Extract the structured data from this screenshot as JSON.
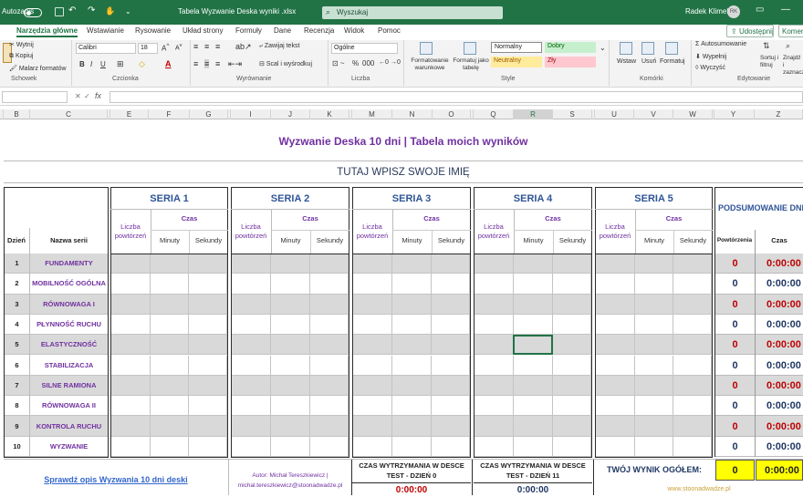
{
  "titlebar": {
    "autosave_label": "Autozapis",
    "doc_title": "Tabela Wyzwanie Deska wyniki .xlsx",
    "search_placeholder": "Wyszukaj",
    "user_name": "Radek Klimek",
    "user_initials": "RK"
  },
  "tabs": [
    "Narzędzia główne",
    "Wstawianie",
    "Rysowanie",
    "Układ strony",
    "Formuły",
    "Dane",
    "Recenzja",
    "Widok",
    "Pomoc"
  ],
  "tabs_active": "Narzędzia główne",
  "share_label": "Udostępnij",
  "comments_label": "Komentarze",
  "ribbon": {
    "clipboard": {
      "cut": "Wytnij",
      "copy": "Kopiuj",
      "format_painter": "Malarz formatów",
      "group": "Schowek"
    },
    "font": {
      "name": "Calibri",
      "size": "18",
      "group": "Czcionka"
    },
    "alignment": {
      "wrap": "Zawijaj tekst",
      "merge": "Scal i wyśrodkuj",
      "group": "Wyrównanie"
    },
    "number": {
      "format": "Ogólne",
      "group": "Liczba"
    },
    "styles": {
      "conditional": "Formatowanie warunkowe",
      "as_table": "Formatuj jako tabelę",
      "normal": "Normalny",
      "good": "Dobry",
      "neutral": "Neutralny",
      "bad": "Zły",
      "group": "Style"
    },
    "cells": {
      "insert": "Wstaw",
      "delete": "Usuń",
      "format": "Formatuj",
      "group": "Komórki"
    },
    "editing": {
      "autosum": "Autosumowanie",
      "fill": "Wypełnij",
      "clear": "Wyczyść",
      "sort": "Sortuj i filtruj",
      "find": "Znajdź i zaznacz",
      "group": "Edytowanie"
    }
  },
  "columns": [
    "A",
    "B",
    "C",
    "D",
    "E",
    "F",
    "G",
    "H",
    "I",
    "J",
    "K",
    "L",
    "M",
    "N",
    "O",
    "P",
    "Q",
    "R",
    "S",
    "T",
    "U",
    "V",
    "W",
    "X",
    "Y",
    "Z"
  ],
  "selected_column": "R",
  "sheet": {
    "title": "Wyzwanie Deska 10 dni | Tabela moich  wyników",
    "name_prompt": "TUTAJ WPISZ SWOJE IMIĘ",
    "series": [
      "SERIA 1",
      "SERIA 2",
      "SERIA 3",
      "SERIA 4",
      "SERIA 5"
    ],
    "summary_header": "PODSUMOWANIE DNIA",
    "sub_reps": "Liczba powtórzeń",
    "sub_time": "Czas",
    "sub_minutes": "Minuty",
    "sub_seconds": "Sekundy",
    "col_day": "Dzień",
    "col_name": "Nazwa serii",
    "col_reps_short": "Powtórzenia",
    "col_time_short": "Czas",
    "rows": [
      {
        "day": "1",
        "name": "FUNDAMENTY",
        "reps": "0",
        "time": "0:00:00"
      },
      {
        "day": "2",
        "name": "MOBILNOŚĆ OGÓLNA",
        "reps": "0",
        "time": "0:00:00"
      },
      {
        "day": "3",
        "name": "RÓWNOWAGA I",
        "reps": "0",
        "time": "0:00:00"
      },
      {
        "day": "4",
        "name": "PŁYNNOŚĆ RUCHU",
        "reps": "0",
        "time": "0:00:00"
      },
      {
        "day": "5",
        "name": "ELASTYCZNOŚĆ",
        "reps": "0",
        "time": "0:00:00"
      },
      {
        "day": "6",
        "name": "STABILIZACJA",
        "reps": "0",
        "time": "0:00:00"
      },
      {
        "day": "7",
        "name": "SILNE RAMIONA",
        "reps": "0",
        "time": "0:00:00"
      },
      {
        "day": "8",
        "name": "RÓWNOWAGA II",
        "reps": "0",
        "time": "0:00:00"
      },
      {
        "day": "9",
        "name": "KONTROLA RUCHU",
        "reps": "0",
        "time": "0:00:00"
      },
      {
        "day": "10",
        "name": "WYZWANIE",
        "reps": "0",
        "time": "0:00:00"
      }
    ],
    "footer": {
      "link": "Sprawdź opis Wyzwania 10 dni deski",
      "author1": "Autor: Michał Tereszkiewicz |",
      "author2": "michal.tereszkiewicz@stoonadwadze.pl",
      "test0": "CZAS WYTRZYMANIA W DESCE TEST - DZIEŃ 0",
      "test11": "CZAS WYTRZYMANIA W DESCE TEST - DZIEŃ 11",
      "test_time": "0:00:00",
      "result_label": "TWÓJ WYNIK OGÓŁEM:",
      "result_reps": "0",
      "result_time": "0:00:00",
      "website": "www.stoonadwadze.pl"
    }
  },
  "colors": {
    "brand": "#217346",
    "purple": "#7030a0",
    "blue_title": "#2f4f8f",
    "red": "#c00000",
    "navy": "#1f3864",
    "row_shade": "#d9d9d9",
    "yellow": "#ffff00"
  }
}
